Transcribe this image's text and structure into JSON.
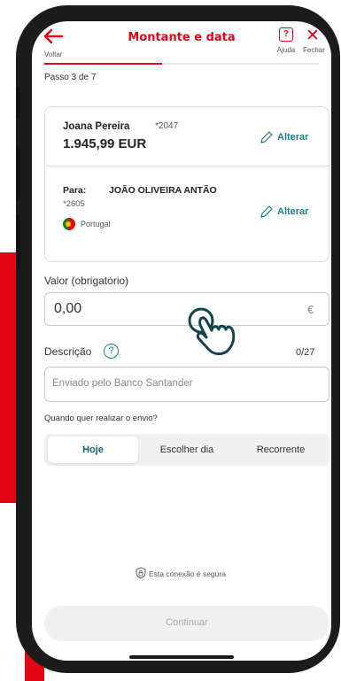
{
  "colors": {
    "brand_red": "#e30613",
    "link_teal": "#1a7f8a",
    "dark_teal": "#0f5e6a"
  },
  "header": {
    "back_label": "Voltar",
    "title": "Montante e data",
    "help_label": "Ajuda",
    "close_label": "Fechar",
    "icons": [
      "back-arrow-icon",
      "help-icon",
      "close-icon"
    ]
  },
  "progress": {
    "current_step": 3,
    "total_steps": 7,
    "fraction": 0.43,
    "label": "Passo 3 de 7"
  },
  "transfer_card": {
    "sender": {
      "name": "Joana Pereira",
      "account": "*2047",
      "balance": "1.945,99 EUR",
      "edit_label": "Alterar"
    },
    "recipient": {
      "prefix": "Para:",
      "name": "JOÃO OLIVEIRA ANTÃO",
      "account": "*2605",
      "country": "Portugal",
      "edit_label": "Alterar"
    }
  },
  "form": {
    "amount": {
      "label": "Valor (obrigatório)",
      "value": "0,00",
      "currency_symbol": "€"
    },
    "description": {
      "label": "Descrição",
      "info_symbol": "?",
      "counter": "0/27",
      "placeholder": "Enviado pelo Banco Santander"
    },
    "when": {
      "question": "Quando quer realizar o envio?",
      "options": [
        "Hoje",
        "Escolher dia",
        "Recorrente"
      ],
      "selected": "Hoje"
    }
  },
  "footer": {
    "secure_text": "Esta conexão é segura",
    "continue_label": "Continuar"
  }
}
